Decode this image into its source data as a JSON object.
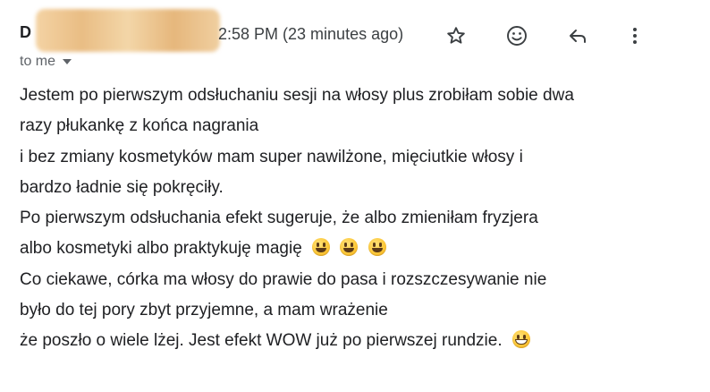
{
  "sender": {
    "initial": "D"
  },
  "header": {
    "timestamp": "2:58 PM (23 minutes ago)",
    "recipients_label": "to me"
  },
  "actions": {
    "star_icon": "star-icon",
    "emoji_react_icon": "smiley-icon",
    "reply_icon": "reply-icon",
    "more_icon": "more-vert-icon",
    "icon_color": "#3c4043"
  },
  "message": {
    "lines": [
      "Jestem po pierwszym odsłuchaniu sesji na włosy plus zrobiłam sobie dwa",
      "razy płukankę z końca nagrania",
      "i bez zmiany kosmetyków mam super nawilżone, mięciutkie włosy i",
      "bardzo ładnie się pokręciły.",
      "Po pierwszym odsłuchania efekt sugeruje, że albo zmieniłam fryzjera",
      "albo kosmetyki albo praktykuję magię",
      "Co ciekawe, córka ma włosy do prawie do pasa i rozszczesywanie nie",
      "było do tej pory zbyt przyjemne, a mam wrażenie",
      "że poszło o wiele lżej. Jest efekt WOW już po pierwszej rundzie."
    ],
    "emojis": {
      "line6": [
        "grinning-face-emoji",
        "grinning-face-emoji",
        "grinning-face-emoji"
      ],
      "line9": [
        "grinning-face-with-smiling-eyes-emoji"
      ]
    }
  }
}
